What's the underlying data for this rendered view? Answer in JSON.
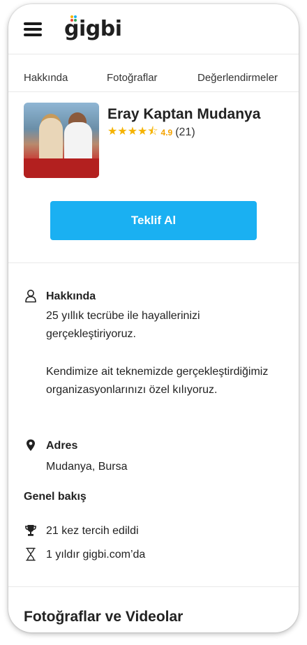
{
  "header": {
    "logo_text": "gigbi",
    "logo_dot_colors": [
      "#f5b301",
      "#1ab0f2",
      "#e8453c",
      "#34a853"
    ]
  },
  "tabs": [
    {
      "label": "Hakkında"
    },
    {
      "label": "Fotoğraflar"
    },
    {
      "label": "Değerlendirmeler"
    }
  ],
  "vendor": {
    "name": "Eray Kaptan Mudanya",
    "stars": "★★★★⯪",
    "rating": "4.9",
    "review_count": "(21)"
  },
  "cta": {
    "label": "Teklif Al",
    "color": "#1ab0f2"
  },
  "about": {
    "title": "Hakkında",
    "paragraph1": "25 yıllık tecrübe ile hayallerinizi gerçekleştiriyoruz.",
    "paragraph2": "Kendimize ait teknemizde gerçekleştirdiğimiz organizasyonlarınızı özel kılıyoruz."
  },
  "address": {
    "title": "Adres",
    "value": "Mudanya, Bursa"
  },
  "overview": {
    "title": "Genel bakış",
    "items": [
      {
        "icon": "trophy-icon",
        "text": "21 kez tercih edildi"
      },
      {
        "icon": "hourglass-icon",
        "text": "1 yıldır gigbi.com’da"
      }
    ]
  },
  "photos_section": {
    "title": "Fotoğraflar ve Videolar"
  }
}
